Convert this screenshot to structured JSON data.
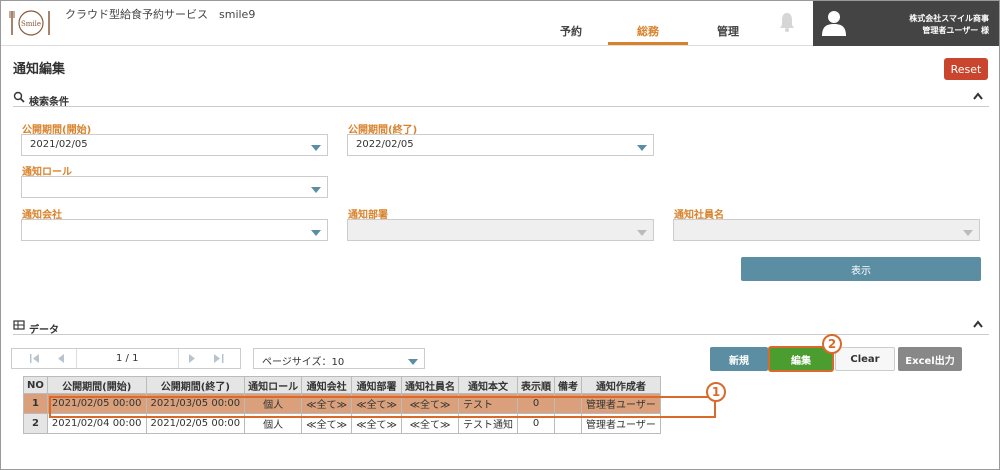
{
  "app": {
    "title": "クラウド型給食予約サービス　smile9",
    "logo_text": "Smile"
  },
  "nav": {
    "items": [
      "予約",
      "総務",
      "管理"
    ],
    "active": "総務"
  },
  "user": {
    "company": "株式会社スマイル商事",
    "name": "管理者ユーザー 様"
  },
  "page": {
    "title": "通知編集",
    "reset_label": "Reset"
  },
  "search": {
    "section_label": "検索条件",
    "start_label": "公開期間(開始)",
    "start_value": "2021/02/05",
    "end_label": "公開期間(終了)",
    "end_value": "2022/02/05",
    "role_label": "通知ロール",
    "role_value": "",
    "company_label": "通知会社",
    "company_value": "",
    "dept_label": "通知部署",
    "dept_value": "",
    "employee_label": "通知社員名",
    "employee_value": "",
    "button_label": "表示"
  },
  "data_section": {
    "label": "データ",
    "pager": {
      "text": "1 / 1"
    },
    "page_size": "ページサイズ：10",
    "buttons": {
      "new": "新規",
      "edit": "編集",
      "clear": "Clear",
      "excel": "Excel出力"
    },
    "badges": {
      "edit": "2",
      "row": "1"
    }
  },
  "table": {
    "columns": [
      "NO",
      "公開期間(開始)",
      "公開期間(終了)",
      "通知ロール",
      "通知会社",
      "通知部署",
      "通知社員名",
      "通知本文",
      "表示順",
      "備考",
      "通知作成者"
    ],
    "rows": [
      [
        "1",
        "2021/02/05 00:00",
        "2021/03/05 00:00",
        "個人",
        "≪全て≫",
        "≪全て≫",
        "≪全て≫",
        "テスト",
        "0",
        "",
        "管理者ユーザー"
      ],
      [
        "2",
        "2021/02/04 00:00",
        "2021/02/05 00:00",
        "個人",
        "≪全て≫",
        "≪全て≫",
        "≪全て≫",
        "テスト通知",
        "0",
        "",
        "管理者ユーザー"
      ]
    ],
    "selected_row": 0
  },
  "colors": {
    "accent": "#d9822b",
    "primary": "#5b8ea3",
    "edit": "#4a9d2e",
    "reset": "#c9452d",
    "highlight": "#d9a07b"
  }
}
